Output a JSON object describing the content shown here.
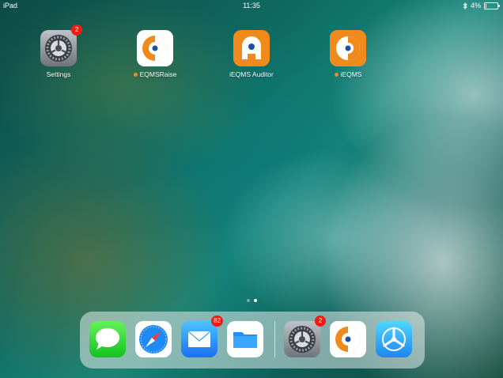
{
  "status_bar": {
    "device": "iPad",
    "time": "11:35",
    "battery_percent": "4%",
    "battery_level": 0.04
  },
  "home_apps": [
    {
      "label": "Settings",
      "badge": "2",
      "new_dot": false
    },
    {
      "label": "EQMSRaise",
      "badge": "",
      "new_dot": true
    },
    {
      "label": "iEQMS Auditor",
      "badge": "",
      "new_dot": false
    },
    {
      "label": "iEQMS",
      "badge": "",
      "new_dot": true
    }
  ],
  "page_indicator": {
    "pages": 2,
    "current": 2
  },
  "dock": {
    "apps": [
      {
        "name": "Messages",
        "icon": "messages-icon",
        "badge": ""
      },
      {
        "name": "Safari",
        "icon": "safari-compass-icon",
        "badge": ""
      },
      {
        "name": "Mail",
        "icon": "mail-envelope-icon",
        "badge": "82"
      },
      {
        "name": "Files",
        "icon": "folder-icon",
        "badge": ""
      }
    ],
    "recent_apps": [
      {
        "name": "Settings",
        "icon": "gear-icon",
        "badge": "2"
      },
      {
        "name": "EQMSRaise",
        "icon": "eqms-logo-icon",
        "badge": ""
      },
      {
        "name": "TestFlight",
        "icon": "propeller-icon",
        "badge": ""
      }
    ]
  },
  "colors": {
    "accent_orange": "#f08a1c",
    "badge_red": "#f21b14",
    "eqms_blue": "#1e4fa8"
  }
}
